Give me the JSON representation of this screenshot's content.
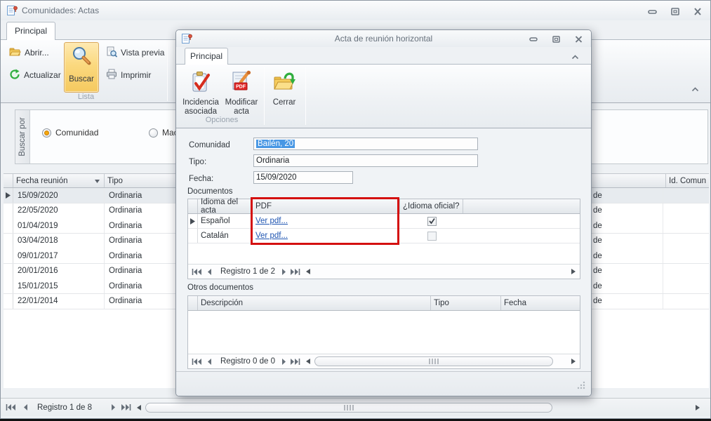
{
  "colors": {
    "accent_orange": "#f8cf6d",
    "highlight_red": "#d41010",
    "selection_blue": "#4897e4",
    "link_blue": "#2056b2"
  },
  "main_window": {
    "title": "Comunidades: Actas",
    "tab_label": "Principal",
    "ribbon": {
      "abrir_label": "Abrir...",
      "actualizar_label": "Actualizar",
      "buscar_label": "Buscar",
      "vista_previa_label": "Vista previa",
      "imprimir_label": "Imprimir",
      "group_label": "Lista"
    },
    "search_panel": {
      "side_label": "Buscar por",
      "radios": [
        {
          "label": "Comunidad",
          "selected": true
        },
        {
          "label": "Macrocomunid",
          "selected": false
        }
      ]
    },
    "grid": {
      "col_fecha": "Fecha reunión",
      "col_tipo": "Tipo",
      "col_id": "Id. Comun",
      "partial_text": "de",
      "selected_row": 0,
      "rows": [
        {
          "fecha": "15/09/2020",
          "tipo": "Ordinaria"
        },
        {
          "fecha": "22/05/2020",
          "tipo": "Ordinaria"
        },
        {
          "fecha": "01/04/2019",
          "tipo": "Ordinaria"
        },
        {
          "fecha": "03/04/2018",
          "tipo": "Ordinaria"
        },
        {
          "fecha": "09/01/2017",
          "tipo": "Ordinaria"
        },
        {
          "fecha": "20/01/2016",
          "tipo": "Ordinaria"
        },
        {
          "fecha": "15/01/2015",
          "tipo": "Ordinaria"
        },
        {
          "fecha": "22/01/2014",
          "tipo": "Ordinaria"
        }
      ]
    },
    "navigator_label": "Registro 1 de 8"
  },
  "dialog": {
    "title": "Acta de reunión horizontal",
    "tab_label": "Principal",
    "ribbon": {
      "incidencia_label": "Incidencia asociada",
      "modificar_label": "Modificar acta",
      "cerrar_label": "Cerrar",
      "group_label": "Opciones",
      "pdf_badge": "PDF"
    },
    "form": {
      "comunidad_label": "Comunidad",
      "comunidad_value": "Bailén, 20",
      "tipo_label": "Tipo:",
      "tipo_value": "Ordinaria",
      "fecha_label": "Fecha:",
      "fecha_value": "15/09/2020"
    },
    "documentos": {
      "section_label": "Documentos",
      "col_idioma": "Idioma del acta",
      "col_pdf": "PDF",
      "col_oficial": "¿Idioma oficial?",
      "rows": [
        {
          "idioma": "Español",
          "pdf_link": "Ver pdf...",
          "oficial": true
        },
        {
          "idioma": "Catalán",
          "pdf_link": "Ver pdf...",
          "oficial": false
        }
      ],
      "navigator_label": "Registro 1 de 2"
    },
    "otros": {
      "section_label": "Otros documentos",
      "col_descripcion": "Descripción",
      "col_tipo": "Tipo",
      "col_fecha": "Fecha",
      "navigator_label": "Registro 0 de 0"
    }
  }
}
